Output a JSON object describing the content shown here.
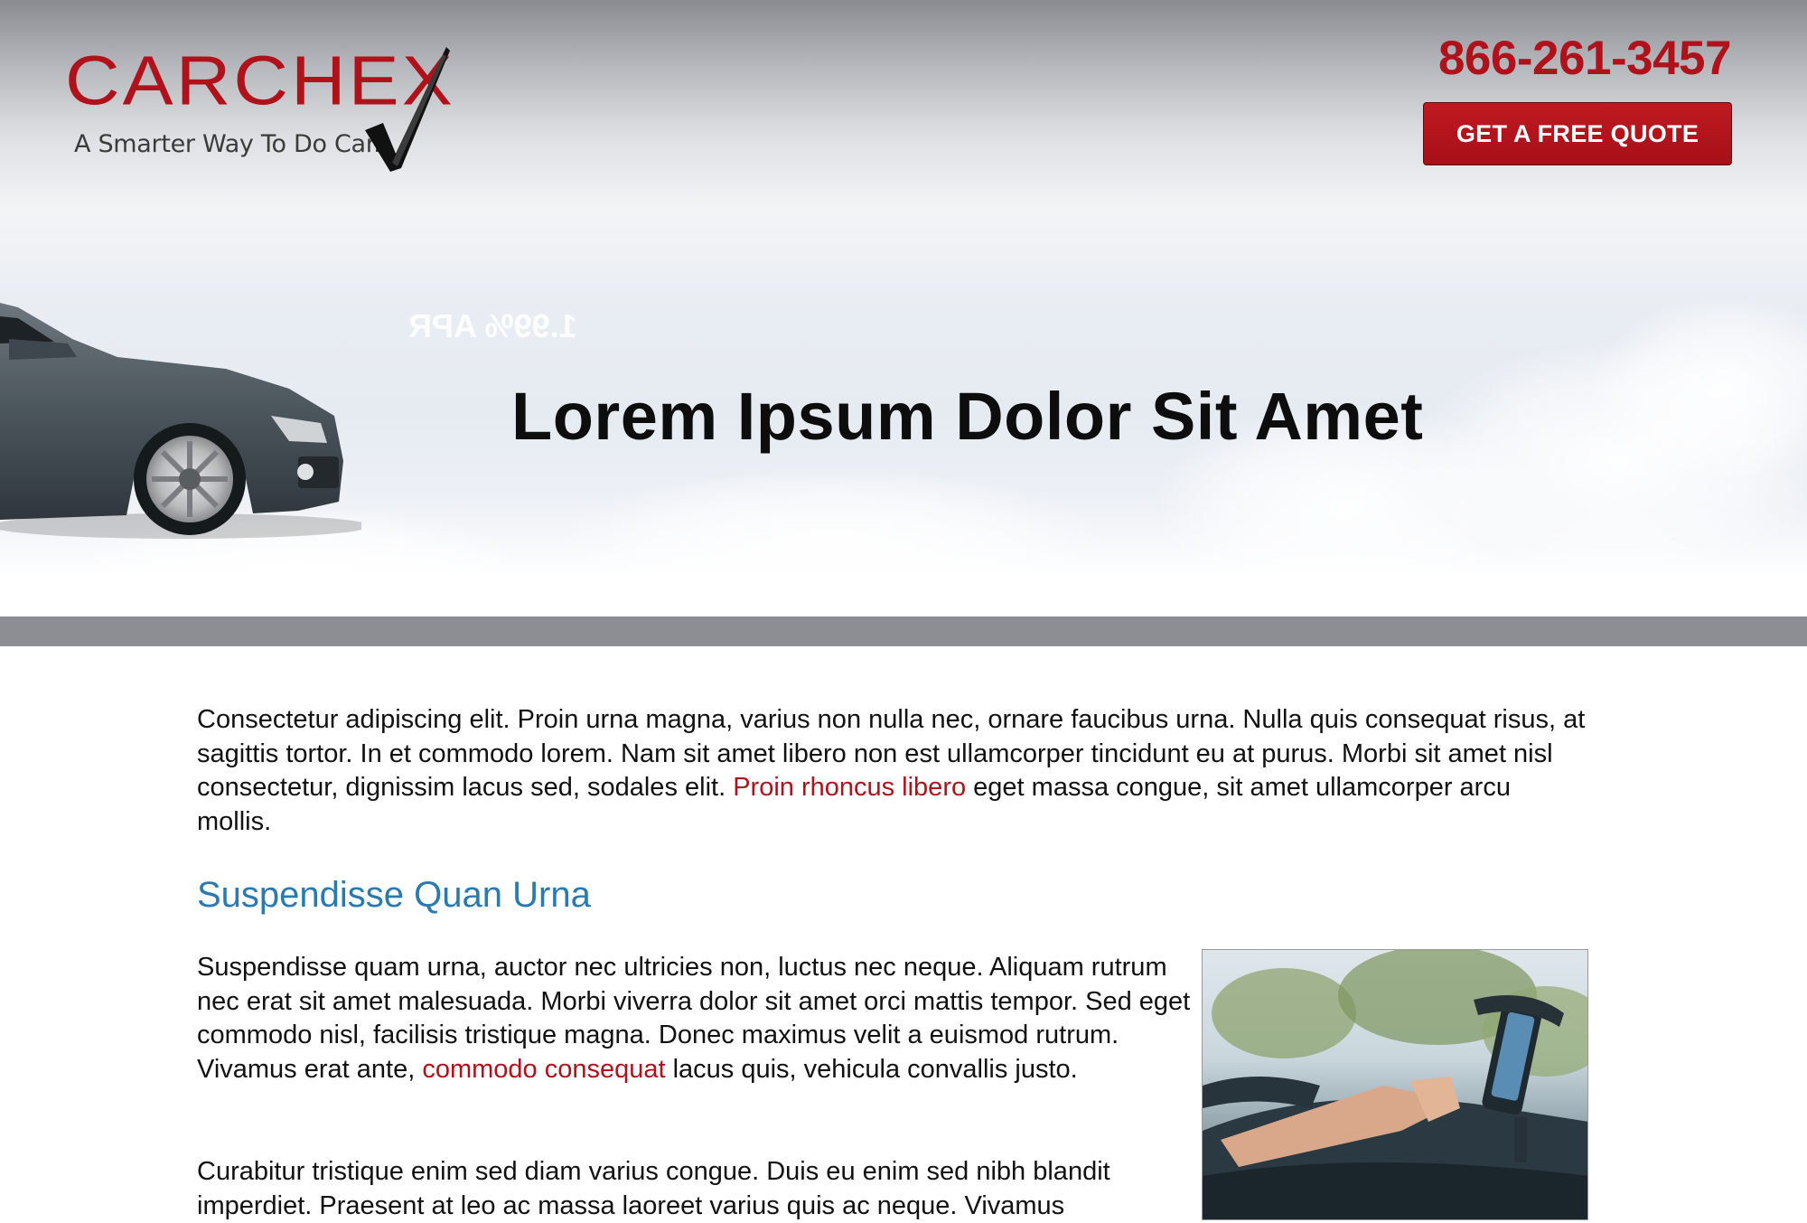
{
  "header": {
    "logo_text": "CARCHEX",
    "logo_tagline": "A Smarter Way To Do Car...",
    "phone": "866-261-3457",
    "quote_button": "GET A FREE QUOTE"
  },
  "hero": {
    "mirrored_text": "1.99% APR",
    "title": "Lorem Ipsum Dolor Sit Amet"
  },
  "intro": {
    "text_before_link": "Consectetur adipiscing elit. Proin urna magna, varius non nulla nec, ornare faucibus urna. Nulla quis consequat risus, at sagittis tortor. In et commodo lorem. Nam sit amet libero non est ullamcorper tincidunt eu at purus. Morbi sit amet nisl consectetur, dignissim lacus sed, sodales elit. ",
    "link": "Proin rhoncus libero",
    "text_after_link": " eget massa congue, sit amet ullamcorper arcu mollis."
  },
  "section": {
    "title": "Suspendisse Quan Urna",
    "p1_before_link": "Suspendisse quam urna, auctor nec ultricies non, luctus nec neque. Aliquam rutrum nec erat sit amet malesuada. Morbi viverra dolor sit amet orci mattis tempor. Sed eget commodo nisl, facilisis tristique magna. Donec maximus velit  a euismod rutrum. Vivamus erat ante, ",
    "p1_link": "commodo consequat",
    "p1_after_link": " lacus quis, vehicula convallis justo.",
    "p2": "Curabitur tristique enim sed diam varius congue. Duis eu enim sed nibh blandit imperdiet. Praesent at leo ac massa laoreet varius quis ac neque. Vivamus"
  },
  "colors": {
    "brand_red": "#b0121b",
    "section_blue": "#2a7ab0",
    "divider_gray": "#8c8e94"
  },
  "icons": {
    "logo_check": "checkmark-icon"
  }
}
